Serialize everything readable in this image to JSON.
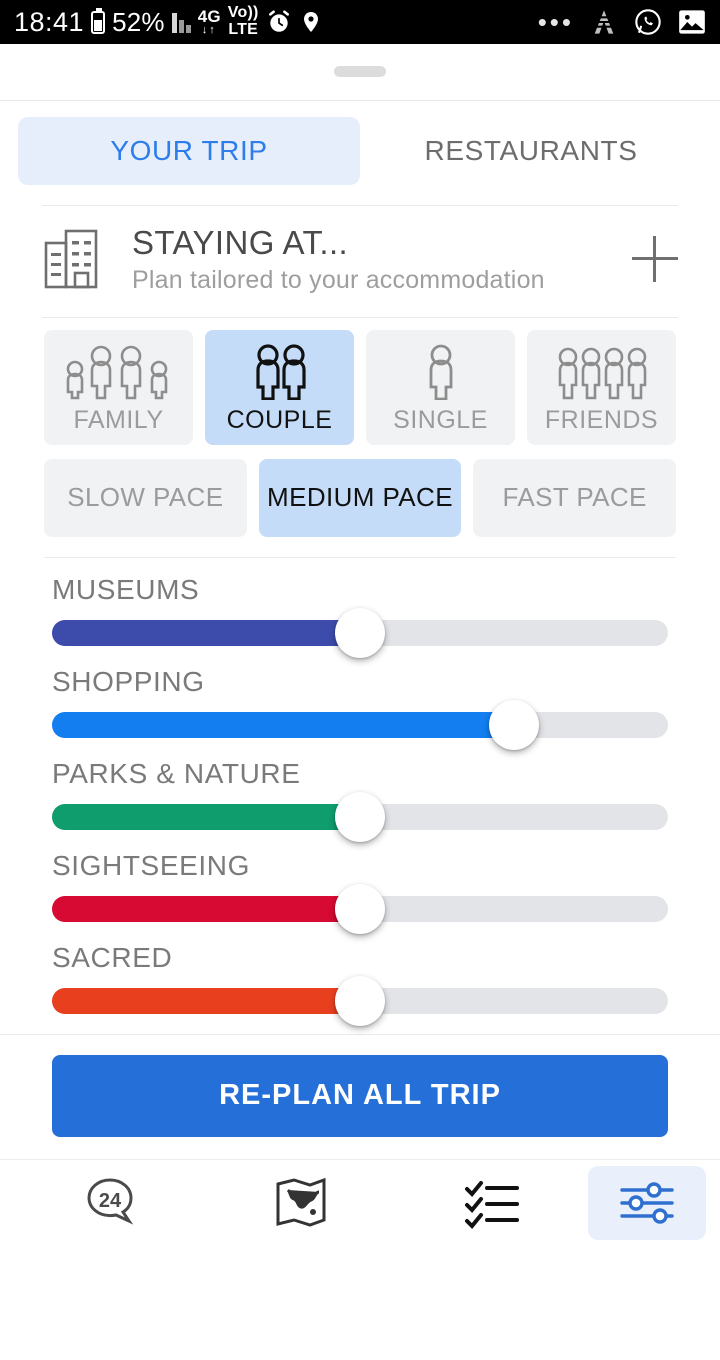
{
  "statusbar": {
    "time": "18:41",
    "battery_percent": "52%",
    "network_type": "4G",
    "network_arrows": "↓↑",
    "volte_top": "Vo))",
    "volte_bottom": "LTE",
    "icons": [
      "battery-icon",
      "signal-icon",
      "4g-icon",
      "volte-icon",
      "alarm-icon",
      "location-icon"
    ],
    "right_icons": [
      "overflow-dots-icon",
      "app-icon",
      "whatsapp-icon",
      "gallery-icon"
    ],
    "dots": "•••"
  },
  "sheet": {
    "handle_label": "drag-handle"
  },
  "tabs": [
    {
      "label": "YOUR TRIP",
      "active": true
    },
    {
      "label": "RESTAURANTS",
      "active": false
    }
  ],
  "staying": {
    "title": "STAYING AT...",
    "subtitle": "Plan tailored to your accommodation",
    "icon": "hotel-building-icon",
    "add_label": "+"
  },
  "group_types": [
    {
      "label": "FAMILY",
      "icon": "family-group-icon",
      "people": 4,
      "selected": false
    },
    {
      "label": "COUPLE",
      "icon": "couple-icon",
      "people": 2,
      "selected": true
    },
    {
      "label": "SINGLE",
      "icon": "single-person-icon",
      "people": 1,
      "selected": false
    },
    {
      "label": "FRIENDS",
      "icon": "friends-group-icon",
      "people": 4,
      "selected": false
    }
  ],
  "pace_options": [
    {
      "label": "SLOW PACE",
      "selected": false
    },
    {
      "label": "MEDIUM PACE",
      "selected": true
    },
    {
      "label": "FAST PACE",
      "selected": false
    }
  ],
  "preference_sliders": [
    {
      "label": "MUSEUMS",
      "value": 50,
      "color": "#3d4bab"
    },
    {
      "label": "SHOPPING",
      "value": 75,
      "color": "#127ef0"
    },
    {
      "label": "PARKS & NATURE",
      "value": 50,
      "color": "#0f9d6e"
    },
    {
      "label": "SIGHTSEEING",
      "value": 50,
      "color": "#d60a32"
    },
    {
      "label": "SACRED",
      "value": 50,
      "color": "#e8401f"
    }
  ],
  "footer": {
    "cta_label": "RE-PLAN ALL TRIP"
  },
  "bottom_nav": [
    {
      "name": "chat-badge",
      "icon": "chat-bubble-24-icon",
      "badge": "24",
      "active": false
    },
    {
      "name": "map",
      "icon": "map-icon",
      "active": false
    },
    {
      "name": "checklist",
      "icon": "checklist-icon",
      "active": false
    },
    {
      "name": "settings",
      "icon": "sliders-settings-icon",
      "active": true
    }
  ],
  "colors": {
    "accent_blue": "#2570d8",
    "tab_active_bg": "#e6eefc",
    "tab_active_text": "#2d7dea",
    "chip_bg": "#f1f2f4",
    "chip_selected_bg": "#c5dcf8",
    "track_bg": "#e3e4e7"
  }
}
